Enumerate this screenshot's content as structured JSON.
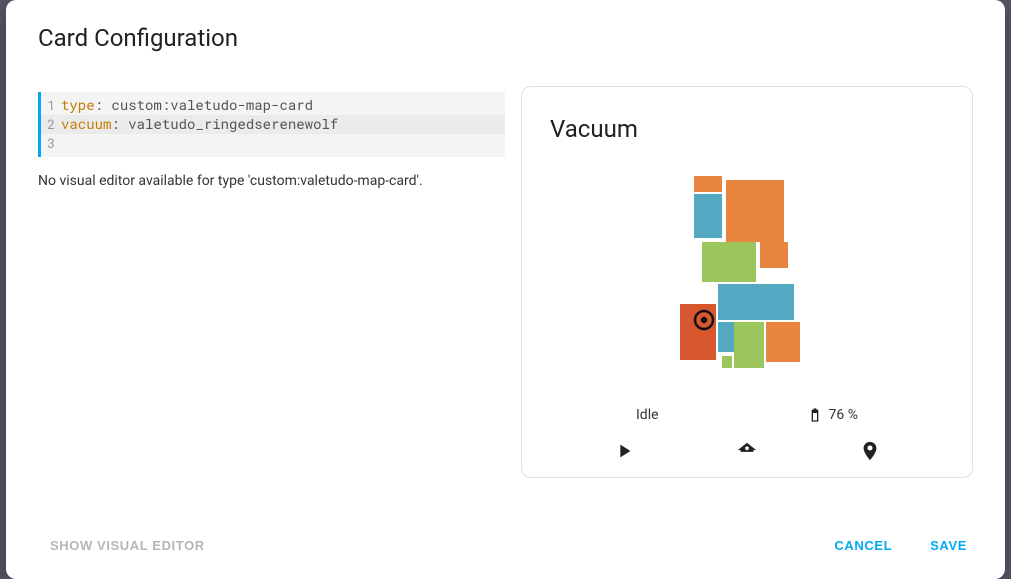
{
  "dialog": {
    "title": "Card Configuration"
  },
  "editor": {
    "lines": [
      {
        "n": "1",
        "key": "type",
        "value": "custom:valetudo-map-card"
      },
      {
        "n": "2",
        "key": "vacuum",
        "value": "valetudo_ringedserenewolf"
      },
      {
        "n": "3",
        "key": "",
        "value": ""
      }
    ],
    "message": "No visual editor available for type 'custom:valetudo-map-card'."
  },
  "preview": {
    "title": "Vacuum",
    "status": "Idle",
    "battery": "76 %"
  },
  "footer": {
    "show_visual": "SHOW VISUAL EDITOR",
    "cancel": "CANCEL",
    "save": "SAVE"
  },
  "colors": {
    "accent": "#03a9f4",
    "map_orange": "#e8863f",
    "map_blue": "#53a9c1",
    "map_green": "#9bc55d"
  }
}
